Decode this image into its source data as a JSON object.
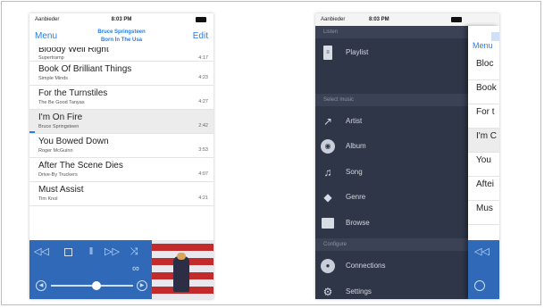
{
  "status": {
    "carrier": "Aanbieder",
    "time": "8:03 PM"
  },
  "nav": {
    "menu_label": "Menu",
    "edit_label": "Edit",
    "now_playing_artist": "Bruce Springsteen",
    "now_playing_album": "Born In The Usa"
  },
  "tracks": [
    {
      "title": "Bloody Well Right",
      "artist": "Supertramp",
      "duration": "4:17"
    },
    {
      "title": "Book Of Brilliant Things",
      "artist": "Simple Minds",
      "duration": "4:23"
    },
    {
      "title": "For the Turnstiles",
      "artist": "The Be Good Tanyas",
      "duration": "4:27"
    },
    {
      "title": "I'm On Fire",
      "artist": "Bruce Springsteen",
      "duration": "2:42",
      "selected": true
    },
    {
      "title": "You Bowed Down",
      "artist": "Roger McGuinn",
      "duration": "3:53"
    },
    {
      "title": "After The Scene Dies",
      "artist": "Drive-By Truckers",
      "duration": "4:07"
    },
    {
      "title": "Must Assist",
      "artist": "Tim Knol",
      "duration": "4:21"
    }
  ],
  "player": {
    "volume_fraction": 0.55
  },
  "drawer": {
    "sections": [
      {
        "label": "Listen"
      },
      {
        "label": "Select music"
      },
      {
        "label": "Configure"
      }
    ],
    "items": [
      {
        "label": "Playlist",
        "icon": "playlist-icon"
      },
      {
        "label": "Artist",
        "icon": "microphone-icon"
      },
      {
        "label": "Album",
        "icon": "disc-icon"
      },
      {
        "label": "Song",
        "icon": "music-note-icon"
      },
      {
        "label": "Genre",
        "icon": "tag-icon"
      },
      {
        "label": "Browse",
        "icon": "folder-icon"
      },
      {
        "label": "Connections",
        "icon": "connections-icon"
      },
      {
        "label": "Settings",
        "icon": "gear-icon"
      }
    ]
  },
  "peek": {
    "menu_label": "Menu",
    "rows": [
      "Bloc",
      "Book",
      "For t",
      "I'm C",
      "You",
      "Aftei",
      "Mus"
    ]
  },
  "colors": {
    "accent": "#2a7de1",
    "player_bg": "#2f69b8",
    "drawer_bg": "#2f3648"
  }
}
